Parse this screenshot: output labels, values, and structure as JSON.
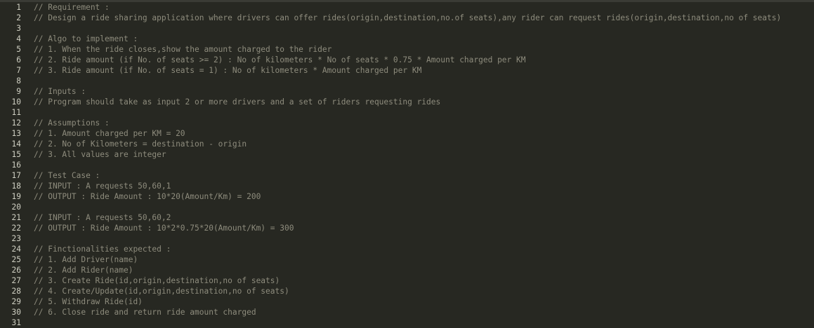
{
  "editor": {
    "lines": [
      {
        "n": "1",
        "text": "// Requirement :"
      },
      {
        "n": "2",
        "text": "// Design a ride sharing application where drivers can offer rides(origin,destination,no.of seats),any rider can request rides(origin,destination,no of seats)"
      },
      {
        "n": "3",
        "text": ""
      },
      {
        "n": "4",
        "text": "// Algo to implement :"
      },
      {
        "n": "5",
        "text": "// 1. When the ride closes,show the amount charged to the rider"
      },
      {
        "n": "6",
        "text": "// 2. Ride amount (if No. of seats >= 2) : No of kilometers * No of seats * 0.75 * Amount charged per KM"
      },
      {
        "n": "7",
        "text": "// 3. Ride amount (if No. of seats = 1) : No of kilometers * Amount charged per KM"
      },
      {
        "n": "8",
        "text": ""
      },
      {
        "n": "9",
        "text": "// Inputs :"
      },
      {
        "n": "10",
        "text": "// Program should take as input 2 or more drivers and a set of riders requesting rides"
      },
      {
        "n": "11",
        "text": ""
      },
      {
        "n": "12",
        "text": "// Assumptions :"
      },
      {
        "n": "13",
        "text": "// 1. Amount charged per KM = 20"
      },
      {
        "n": "14",
        "text": "// 2. No of Kilometers = destination - origin"
      },
      {
        "n": "15",
        "text": "// 3. All values are integer"
      },
      {
        "n": "16",
        "text": ""
      },
      {
        "n": "17",
        "text": "// Test Case :"
      },
      {
        "n": "18",
        "text": "// INPUT : A requests 50,60,1"
      },
      {
        "n": "19",
        "text": "// OUTPUT : Ride Amount : 10*20(Amount/Km) = 200"
      },
      {
        "n": "20",
        "text": ""
      },
      {
        "n": "21",
        "text": "// INPUT : A requests 50,60,2"
      },
      {
        "n": "22",
        "text": "// OUTPUT : Ride Amount : 10*2*0.75*20(Amount/Km) = 300"
      },
      {
        "n": "23",
        "text": ""
      },
      {
        "n": "24",
        "text": "// Finctionalities expected :"
      },
      {
        "n": "25",
        "text": "// 1. Add Driver(name)"
      },
      {
        "n": "26",
        "text": "// 2. Add Rider(name)"
      },
      {
        "n": "27",
        "text": "// 3. Create Ride(id,origin,destination,no of seats)"
      },
      {
        "n": "28",
        "text": "// 4. Create/Update(id,origin,destination,no of seats)"
      },
      {
        "n": "29",
        "text": "// 5. Withdraw Ride(id)"
      },
      {
        "n": "30",
        "text": "// 6. Close ride and return ride amount charged"
      },
      {
        "n": "31",
        "text": ""
      }
    ]
  }
}
